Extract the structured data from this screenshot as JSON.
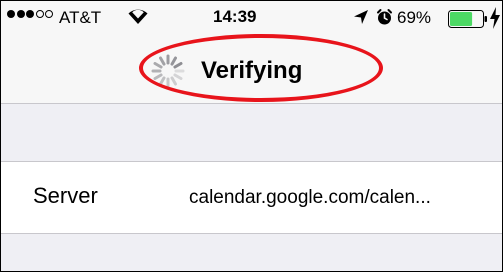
{
  "status_bar": {
    "signal_bars_filled": 3,
    "signal_bars_total": 5,
    "carrier": "AT&T",
    "time": "14:39",
    "battery_percent": "69%",
    "battery_level": 0.69,
    "icons": [
      "wifi-icon",
      "location-arrow-icon",
      "alarm-clock-icon",
      "battery-icon",
      "charging-bolt-icon"
    ]
  },
  "nav": {
    "title": "Verifying",
    "spinner": "activity-spinner-icon"
  },
  "annotation": {
    "color": "#e8141b"
  },
  "form": {
    "server_label": "Server",
    "server_value": "calendar.google.com/calen..."
  },
  "colors": {
    "bar_background": "#f7f7f7",
    "group_background": "#efeff4",
    "separator": "#c8c7cc",
    "battery_fill": "#4cd964"
  }
}
